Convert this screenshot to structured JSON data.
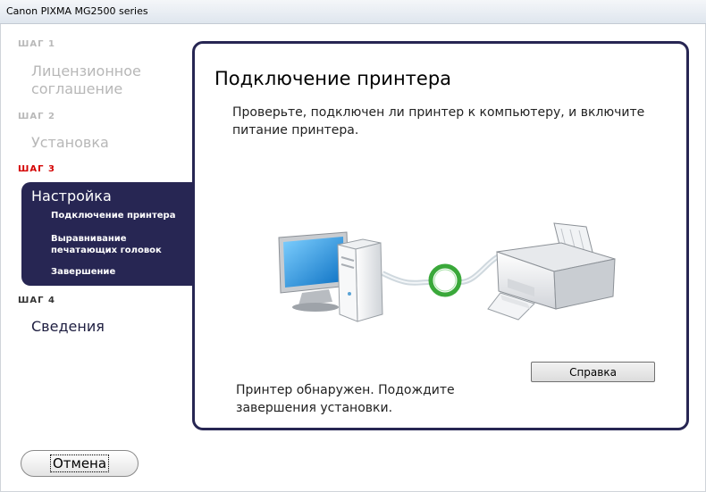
{
  "window": {
    "title": "Canon PIXMA MG2500 series"
  },
  "sidebar": {
    "steps": [
      {
        "label": "ШАГ 1",
        "name": "Лицензионное соглашение"
      },
      {
        "label": "ШАГ 2",
        "name": "Установка"
      },
      {
        "label": "ШАГ 3",
        "name": "Настройка",
        "substeps": [
          "Подключение принтера",
          "Выравнивание печатающих головок",
          "Завершение"
        ]
      },
      {
        "label": "ШАГ 4",
        "name": "Сведения"
      }
    ]
  },
  "main": {
    "title": "Подключение принтера",
    "instruction": "Проверьте, подключен ли принтер к компьютеру, и включите питание принтера.",
    "status": "Принтер обнаружен. Подождите завершения установки.",
    "help_button": "Справка"
  },
  "footer": {
    "cancel_button": "Отмена"
  },
  "colors": {
    "active_step": "#d40000",
    "nav_active_bg": "#272653",
    "panel_border": "#272653",
    "connection_ok": "#3aa83a"
  }
}
